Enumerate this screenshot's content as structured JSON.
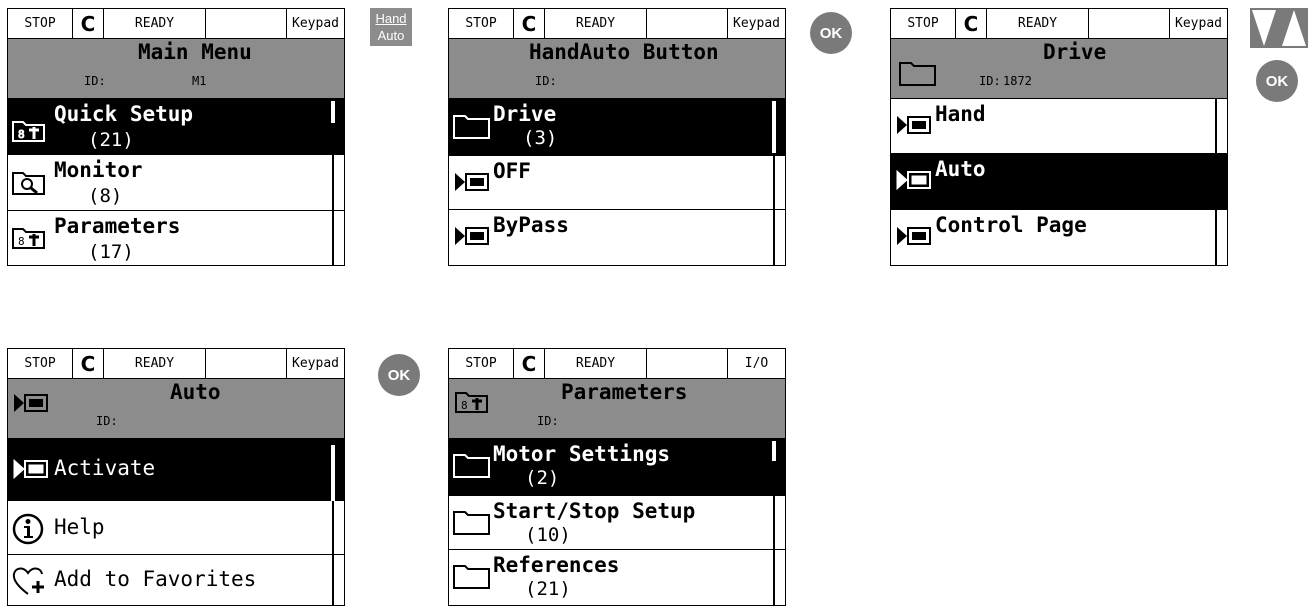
{
  "controls": {
    "hand_auto_line1": "Hand",
    "hand_auto_line2": "Auto",
    "ok_label": "OK",
    "up_down_icon": "up-down-arrows-icon"
  },
  "screens": [
    {
      "status": {
        "state": "STOP",
        "rotation_icon": "rotation-icon",
        "ready": "READY",
        "extra": "",
        "source": "Keypad"
      },
      "header": {
        "title": "Main Menu",
        "id_label": "ID:",
        "id_value": "M1",
        "icon": ""
      },
      "items": [
        {
          "label": "Quick Setup",
          "count": "(21)",
          "icon": "parameters-folder-icon",
          "selected": true
        },
        {
          "label": "Monitor",
          "count": "(8)",
          "icon": "monitor-icon",
          "selected": false
        },
        {
          "label": "Parameters",
          "count": "(17)",
          "icon": "parameters-folder-icon",
          "selected": false
        }
      ]
    },
    {
      "status": {
        "state": "STOP",
        "rotation_icon": "rotation-icon",
        "ready": "READY",
        "extra": "",
        "source": "Keypad"
      },
      "header": {
        "title": "HandAuto Button",
        "id_label": "ID:",
        "id_value": "",
        "icon": ""
      },
      "items": [
        {
          "label": "Drive",
          "count": "(3)",
          "icon": "folder-icon",
          "selected": true
        },
        {
          "label": "OFF",
          "count": "",
          "icon": "action-icon",
          "selected": false
        },
        {
          "label": "ByPass",
          "count": "",
          "icon": "action-icon",
          "selected": false
        }
      ]
    },
    {
      "status": {
        "state": "STOP",
        "rotation_icon": "rotation-icon",
        "ready": "READY",
        "extra": "",
        "source": "Keypad"
      },
      "header": {
        "title": "Drive",
        "id_label": "ID:",
        "id_value": "1872",
        "icon": "folder-icon"
      },
      "items": [
        {
          "label": "Hand",
          "count": "",
          "icon": "action-icon",
          "selected": false
        },
        {
          "label": "Auto",
          "count": "",
          "icon": "action-icon",
          "selected": true
        },
        {
          "label": "Control Page",
          "count": "",
          "icon": "action-icon",
          "selected": false
        }
      ]
    },
    {
      "status": {
        "state": "STOP",
        "rotation_icon": "rotation-icon",
        "ready": "READY",
        "extra": "",
        "source": "Keypad"
      },
      "header": {
        "title": "Auto",
        "id_label": "ID:",
        "id_value": "",
        "icon": "action-icon"
      },
      "items": [
        {
          "label": "Activate",
          "count": "",
          "icon": "action-icon",
          "selected": true
        },
        {
          "label": "Help",
          "count": "",
          "icon": "info-icon",
          "selected": false
        },
        {
          "label": "Add to Favorites",
          "count": "",
          "icon": "heart-plus-icon",
          "selected": false
        }
      ]
    },
    {
      "status": {
        "state": "STOP",
        "rotation_icon": "rotation-icon",
        "ready": "READY",
        "extra": "",
        "source": "I/O"
      },
      "header": {
        "title": "Parameters",
        "id_label": "ID:",
        "id_value": "",
        "icon": "parameters-folder-icon"
      },
      "items": [
        {
          "label": "Motor Settings",
          "count": "(2)",
          "icon": "folder-icon",
          "selected": true
        },
        {
          "label": "Start/Stop Setup",
          "count": "(10)",
          "icon": "folder-icon",
          "selected": false
        },
        {
          "label": "References",
          "count": "(21)",
          "icon": "folder-icon",
          "selected": false
        }
      ]
    }
  ]
}
